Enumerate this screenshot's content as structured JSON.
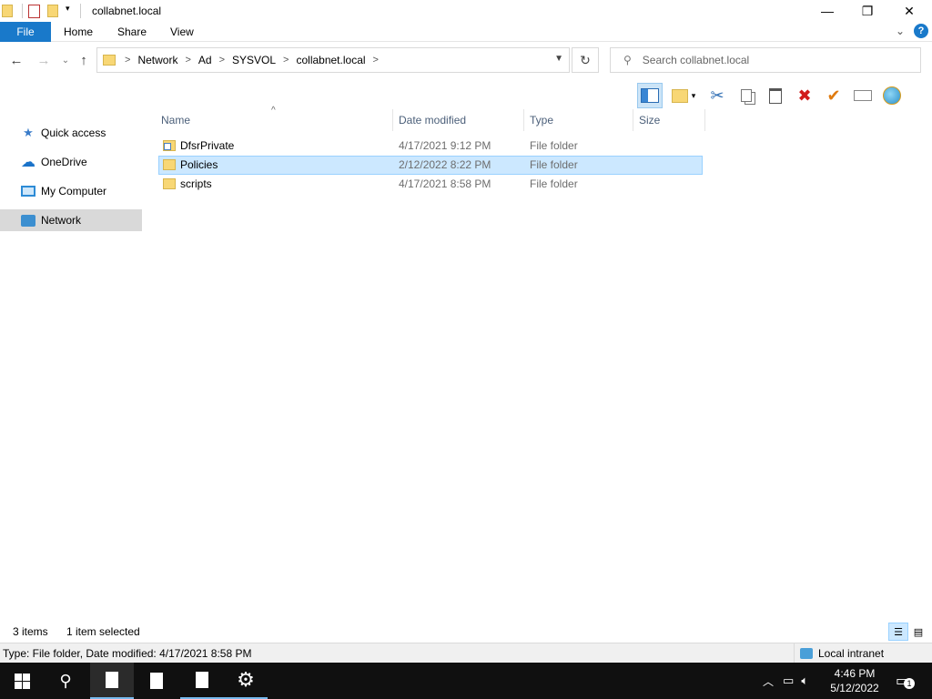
{
  "window": {
    "title": "collabnet.local",
    "minimize_glyph": "—",
    "restore_glyph": "❐",
    "close_glyph": "✕"
  },
  "ribbon": {
    "tabs": [
      {
        "label": "File"
      },
      {
        "label": "Home"
      },
      {
        "label": "Share"
      },
      {
        "label": "View"
      }
    ],
    "help_glyph": "?",
    "expand_glyph": "⌄"
  },
  "nav": {
    "back_glyph": "←",
    "forward_glyph": "→",
    "recent_glyph": "⌄",
    "up_glyph": "↑",
    "breadcrumbs": [
      "Network",
      "Ad",
      "SYSVOL",
      "collabnet.local"
    ],
    "crumb_sep": ">",
    "refresh_glyph": "↻",
    "search_placeholder": "Search collabnet.local"
  },
  "toolbar": {
    "icons": [
      "preview-pane-icon",
      "new-folder-icon",
      "cut-icon",
      "copy-icon",
      "paste-icon",
      "delete-icon",
      "properties-check-icon",
      "rename-icon",
      "globe-icon"
    ]
  },
  "sidebar": {
    "items": [
      {
        "label": "Quick access",
        "icon": "star-icon",
        "glyph": "★",
        "color": "#3a7cc9"
      },
      {
        "label": "OneDrive",
        "icon": "cloud-icon",
        "glyph": "☁",
        "color": "#1a73c9"
      },
      {
        "label": "My Computer",
        "icon": "computer-icon",
        "glyph": "▭",
        "color": "#2d8bd6"
      },
      {
        "label": "Network",
        "icon": "network-icon",
        "glyph": "▣",
        "color": "#3c8fd0"
      }
    ]
  },
  "columns": {
    "name": "Name",
    "date": "Date modified",
    "type": "Type",
    "size": "Size"
  },
  "files": [
    {
      "name": "DfsrPrivate",
      "date": "4/17/2021 9:12 PM",
      "type": "File folder",
      "size": ""
    },
    {
      "name": "Policies",
      "date": "2/12/2022 8:22 PM",
      "type": "File folder",
      "size": ""
    },
    {
      "name": "scripts",
      "date": "4/17/2021 8:58 PM",
      "type": "File folder",
      "size": ""
    }
  ],
  "status": {
    "item_count": "3 items",
    "selection": "1 item selected"
  },
  "infobar": {
    "details": "Type: File folder, Date modified: 4/17/2021 8:58 PM",
    "zone": "Local intranet"
  },
  "taskbar": {
    "time": "4:46 PM",
    "date": "5/12/2022",
    "notification_count": "1"
  },
  "colors": {
    "accent": "#1979ca",
    "selection": "#cce8ff",
    "folder": "#f8d775"
  }
}
